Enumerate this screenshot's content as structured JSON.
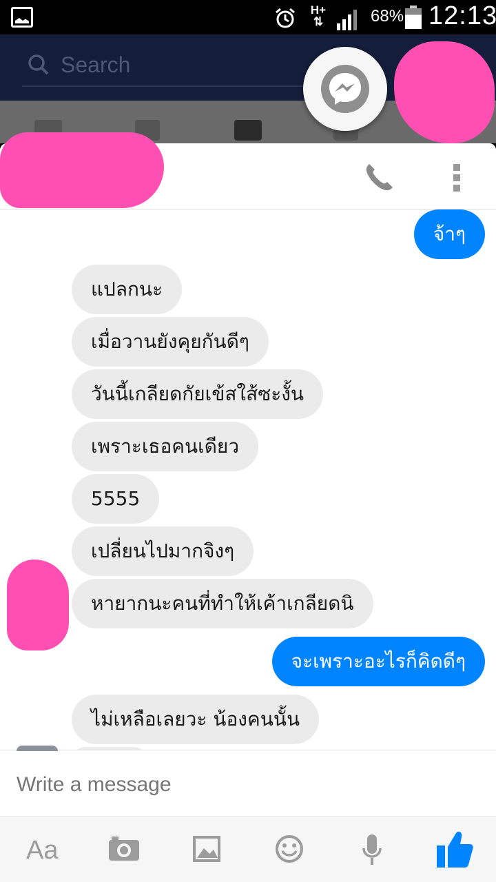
{
  "status_bar": {
    "battery": "68%",
    "network": "H+",
    "time": "12:13",
    "icons": [
      "gallery-notification-icon",
      "alarm-icon",
      "data-arrows-icon",
      "signal-icon",
      "battery-icon"
    ]
  },
  "fb_header": {
    "search_placeholder": "Search",
    "tab_icons": [
      "news-feed-icon",
      "friends-icon",
      "messages-icon",
      "notifications-icon",
      "menu-icon"
    ]
  },
  "chat": {
    "header_icons": [
      "phone-icon",
      "more-options-icon"
    ],
    "messages": [
      {
        "side": "out",
        "text": "จ้าๆ"
      },
      {
        "side": "in",
        "text": "แปลกนะ"
      },
      {
        "side": "in",
        "text": "เมื่อวานยังคุยกันดีๆ"
      },
      {
        "side": "in",
        "text": "วันนี้เกลียดกัยเข้สใส้ซะงั้น"
      },
      {
        "side": "in",
        "text": "เพราะเธอคนเดียว"
      },
      {
        "side": "in",
        "text": "5555"
      },
      {
        "side": "in",
        "text": "เปลี่ยนไปมากจิงๆ"
      },
      {
        "side": "in",
        "text": "หายากนะคนที่ทำให้เค้าเกลียดนิ"
      },
      {
        "side": "out",
        "text": "จะเพราะอะไรก็คิดดีๆ"
      },
      {
        "side": "in",
        "text": "ไม่เหลือเลยวะ น้องคนนั้น"
      }
    ]
  },
  "composer": {
    "placeholder": "Write a message",
    "aa_label": "Aa",
    "toolbar_icons": [
      "text-style-icon",
      "camera-icon",
      "gallery-icon",
      "emoji-icon",
      "microphone-icon",
      "like-icon"
    ],
    "accent_color": "#0084ff"
  }
}
